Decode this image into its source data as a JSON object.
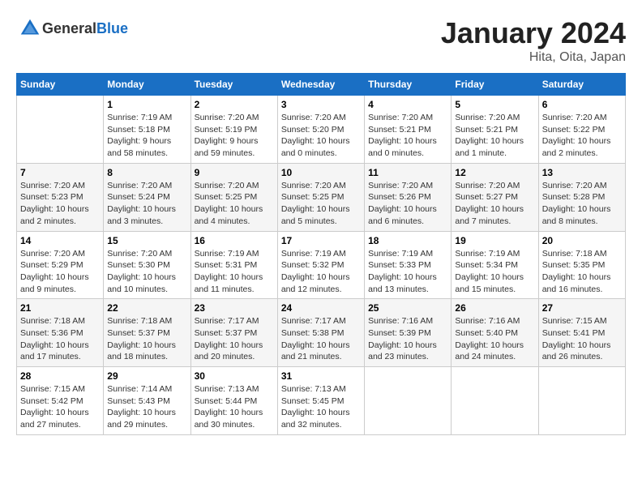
{
  "header": {
    "logo_general": "General",
    "logo_blue": "Blue",
    "title": "January 2024",
    "subtitle": "Hita, Oita, Japan"
  },
  "calendar": {
    "days_of_week": [
      "Sunday",
      "Monday",
      "Tuesday",
      "Wednesday",
      "Thursday",
      "Friday",
      "Saturday"
    ],
    "weeks": [
      [
        {
          "day": "",
          "info": ""
        },
        {
          "day": "1",
          "info": "Sunrise: 7:19 AM\nSunset: 5:18 PM\nDaylight: 9 hours\nand 58 minutes."
        },
        {
          "day": "2",
          "info": "Sunrise: 7:20 AM\nSunset: 5:19 PM\nDaylight: 9 hours\nand 59 minutes."
        },
        {
          "day": "3",
          "info": "Sunrise: 7:20 AM\nSunset: 5:20 PM\nDaylight: 10 hours\nand 0 minutes."
        },
        {
          "day": "4",
          "info": "Sunrise: 7:20 AM\nSunset: 5:21 PM\nDaylight: 10 hours\nand 0 minutes."
        },
        {
          "day": "5",
          "info": "Sunrise: 7:20 AM\nSunset: 5:21 PM\nDaylight: 10 hours\nand 1 minute."
        },
        {
          "day": "6",
          "info": "Sunrise: 7:20 AM\nSunset: 5:22 PM\nDaylight: 10 hours\nand 2 minutes."
        }
      ],
      [
        {
          "day": "7",
          "info": "Sunrise: 7:20 AM\nSunset: 5:23 PM\nDaylight: 10 hours\nand 2 minutes."
        },
        {
          "day": "8",
          "info": "Sunrise: 7:20 AM\nSunset: 5:24 PM\nDaylight: 10 hours\nand 3 minutes."
        },
        {
          "day": "9",
          "info": "Sunrise: 7:20 AM\nSunset: 5:25 PM\nDaylight: 10 hours\nand 4 minutes."
        },
        {
          "day": "10",
          "info": "Sunrise: 7:20 AM\nSunset: 5:25 PM\nDaylight: 10 hours\nand 5 minutes."
        },
        {
          "day": "11",
          "info": "Sunrise: 7:20 AM\nSunset: 5:26 PM\nDaylight: 10 hours\nand 6 minutes."
        },
        {
          "day": "12",
          "info": "Sunrise: 7:20 AM\nSunset: 5:27 PM\nDaylight: 10 hours\nand 7 minutes."
        },
        {
          "day": "13",
          "info": "Sunrise: 7:20 AM\nSunset: 5:28 PM\nDaylight: 10 hours\nand 8 minutes."
        }
      ],
      [
        {
          "day": "14",
          "info": "Sunrise: 7:20 AM\nSunset: 5:29 PM\nDaylight: 10 hours\nand 9 minutes."
        },
        {
          "day": "15",
          "info": "Sunrise: 7:20 AM\nSunset: 5:30 PM\nDaylight: 10 hours\nand 10 minutes."
        },
        {
          "day": "16",
          "info": "Sunrise: 7:19 AM\nSunset: 5:31 PM\nDaylight: 10 hours\nand 11 minutes."
        },
        {
          "day": "17",
          "info": "Sunrise: 7:19 AM\nSunset: 5:32 PM\nDaylight: 10 hours\nand 12 minutes."
        },
        {
          "day": "18",
          "info": "Sunrise: 7:19 AM\nSunset: 5:33 PM\nDaylight: 10 hours\nand 13 minutes."
        },
        {
          "day": "19",
          "info": "Sunrise: 7:19 AM\nSunset: 5:34 PM\nDaylight: 10 hours\nand 15 minutes."
        },
        {
          "day": "20",
          "info": "Sunrise: 7:18 AM\nSunset: 5:35 PM\nDaylight: 10 hours\nand 16 minutes."
        }
      ],
      [
        {
          "day": "21",
          "info": "Sunrise: 7:18 AM\nSunset: 5:36 PM\nDaylight: 10 hours\nand 17 minutes."
        },
        {
          "day": "22",
          "info": "Sunrise: 7:18 AM\nSunset: 5:37 PM\nDaylight: 10 hours\nand 18 minutes."
        },
        {
          "day": "23",
          "info": "Sunrise: 7:17 AM\nSunset: 5:37 PM\nDaylight: 10 hours\nand 20 minutes."
        },
        {
          "day": "24",
          "info": "Sunrise: 7:17 AM\nSunset: 5:38 PM\nDaylight: 10 hours\nand 21 minutes."
        },
        {
          "day": "25",
          "info": "Sunrise: 7:16 AM\nSunset: 5:39 PM\nDaylight: 10 hours\nand 23 minutes."
        },
        {
          "day": "26",
          "info": "Sunrise: 7:16 AM\nSunset: 5:40 PM\nDaylight: 10 hours\nand 24 minutes."
        },
        {
          "day": "27",
          "info": "Sunrise: 7:15 AM\nSunset: 5:41 PM\nDaylight: 10 hours\nand 26 minutes."
        }
      ],
      [
        {
          "day": "28",
          "info": "Sunrise: 7:15 AM\nSunset: 5:42 PM\nDaylight: 10 hours\nand 27 minutes."
        },
        {
          "day": "29",
          "info": "Sunrise: 7:14 AM\nSunset: 5:43 PM\nDaylight: 10 hours\nand 29 minutes."
        },
        {
          "day": "30",
          "info": "Sunrise: 7:13 AM\nSunset: 5:44 PM\nDaylight: 10 hours\nand 30 minutes."
        },
        {
          "day": "31",
          "info": "Sunrise: 7:13 AM\nSunset: 5:45 PM\nDaylight: 10 hours\nand 32 minutes."
        },
        {
          "day": "",
          "info": ""
        },
        {
          "day": "",
          "info": ""
        },
        {
          "day": "",
          "info": ""
        }
      ]
    ]
  }
}
